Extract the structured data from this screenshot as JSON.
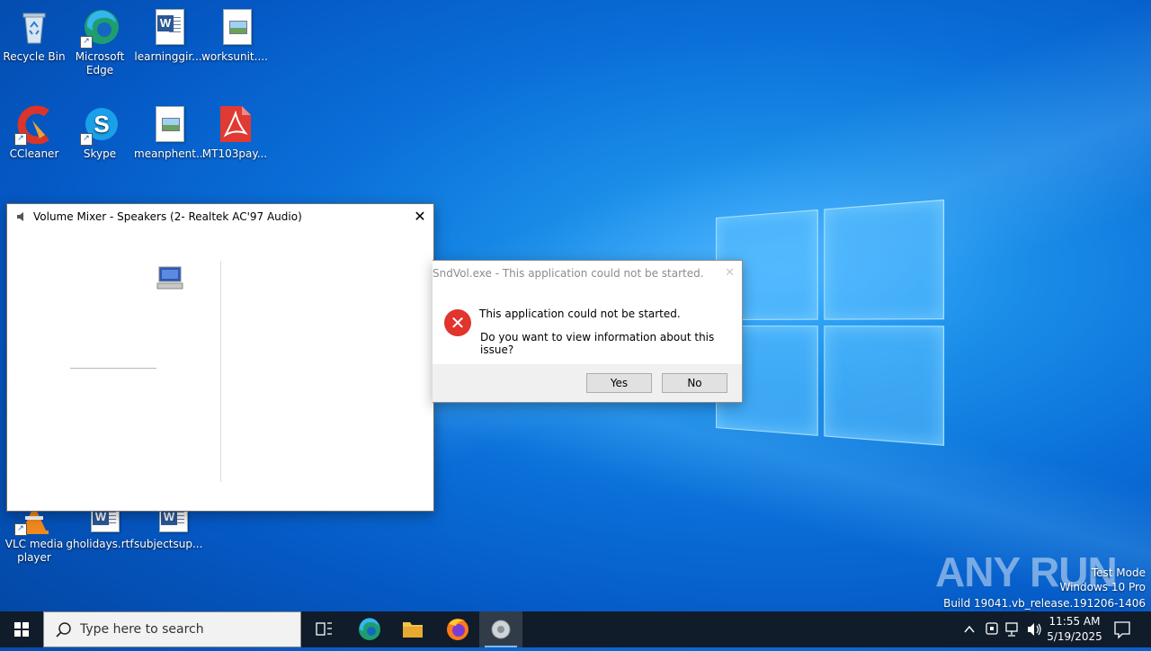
{
  "desktop": {
    "icons": [
      {
        "label": "Recycle Bin",
        "icon": "recycle-bin-icon"
      },
      {
        "label": "Microsoft Edge",
        "icon": "edge-icon"
      },
      {
        "label": "learninggir...",
        "icon": "word-document-icon"
      },
      {
        "label": "worksunit....",
        "icon": "image-file-icon"
      },
      {
        "label": "CCleaner",
        "icon": "ccleaner-icon"
      },
      {
        "label": "Skype",
        "icon": "skype-icon"
      },
      {
        "label": "meanphent...",
        "icon": "image-file-icon"
      },
      {
        "label": "MT103pay...",
        "icon": "pdf-file-icon"
      },
      {
        "label": "VLC media player",
        "icon": "vlc-icon"
      },
      {
        "label": "gholidays.rtf",
        "icon": "word-document-icon"
      },
      {
        "label": "subjectsup...",
        "icon": "word-document-icon"
      }
    ]
  },
  "volume_mixer": {
    "title": "Volume Mixer - Speakers (2- Realtek AC'97 Audio)"
  },
  "error_dialog": {
    "title": "SndVol.exe - This application could not be started.",
    "message": "This application could not be started.",
    "question": "Do you want to view information about this issue?",
    "yes_label": "Yes",
    "no_label": "No"
  },
  "watermark": {
    "brand": "ANY RUN",
    "test_mode": "Test Mode",
    "edition": "Windows 10 Pro",
    "build": "Build 19041.vb_release.191206-1406"
  },
  "taskbar": {
    "search_placeholder": "Type here to search",
    "time": "11:55 AM",
    "date": "5/19/2025"
  },
  "colors": {
    "taskbar": "#101c2a",
    "error_red": "#e0342d",
    "desktop_blue": "#0a6fd8"
  }
}
